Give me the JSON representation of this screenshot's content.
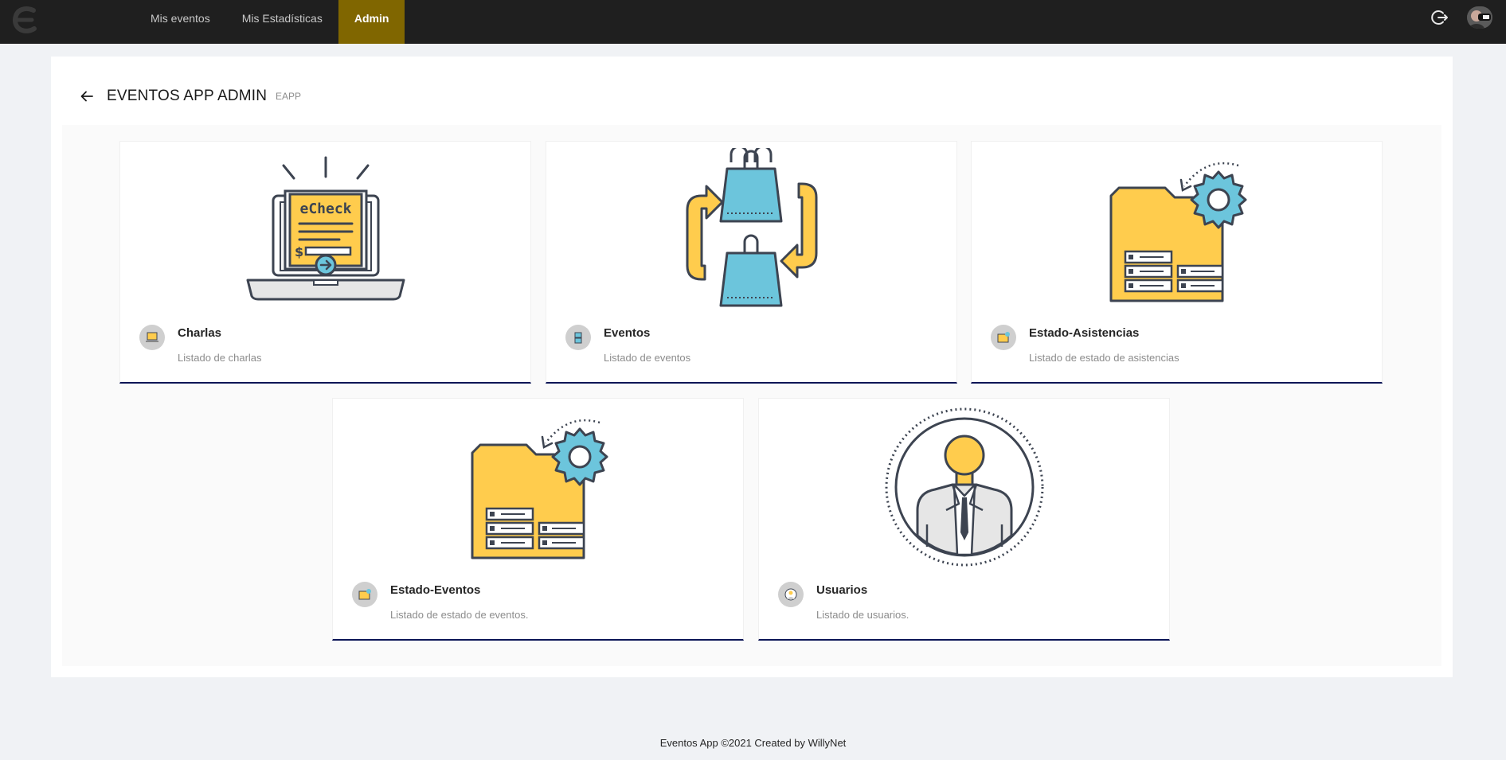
{
  "nav": {
    "items": [
      {
        "label": "Mis eventos",
        "active": false
      },
      {
        "label": "Mis Estadísticas",
        "active": false
      },
      {
        "label": "Admin",
        "active": true
      }
    ],
    "logo_icon": "logo-e-icon",
    "logout_icon": "logout-icon",
    "avatar_icon": "user-avatar"
  },
  "header": {
    "title": "EVENTOS APP ADMIN",
    "subtitle": "EAPP",
    "back_icon": "arrow-left-icon"
  },
  "cards": [
    {
      "title": "Charlas",
      "description": "Listado de charlas",
      "icon": "echeck-laptop-icon"
    },
    {
      "title": "Eventos",
      "description": "Listado de eventos",
      "icon": "shopping-bags-cycle-icon"
    },
    {
      "title": "Estado-Asistencias",
      "description": "Listado de estado de asistencias",
      "icon": "folder-gear-icon"
    },
    {
      "title": "Estado-Eventos",
      "description": "Listado de estado de eventos.",
      "icon": "folder-gear-icon"
    },
    {
      "title": "Usuarios",
      "description": "Listado de usuarios.",
      "icon": "user-circle-icon"
    }
  ],
  "footer": {
    "text": "Eventos App ©2021 Created by WillyNet"
  },
  "colors": {
    "topbar": "#1f1f1f",
    "active_nav": "#806600",
    "card_accent": "#0b1556",
    "illustration_yellow": "#ffcc4d",
    "illustration_blue": "#6cc5dc",
    "illustration_stroke": "#3d4451"
  }
}
